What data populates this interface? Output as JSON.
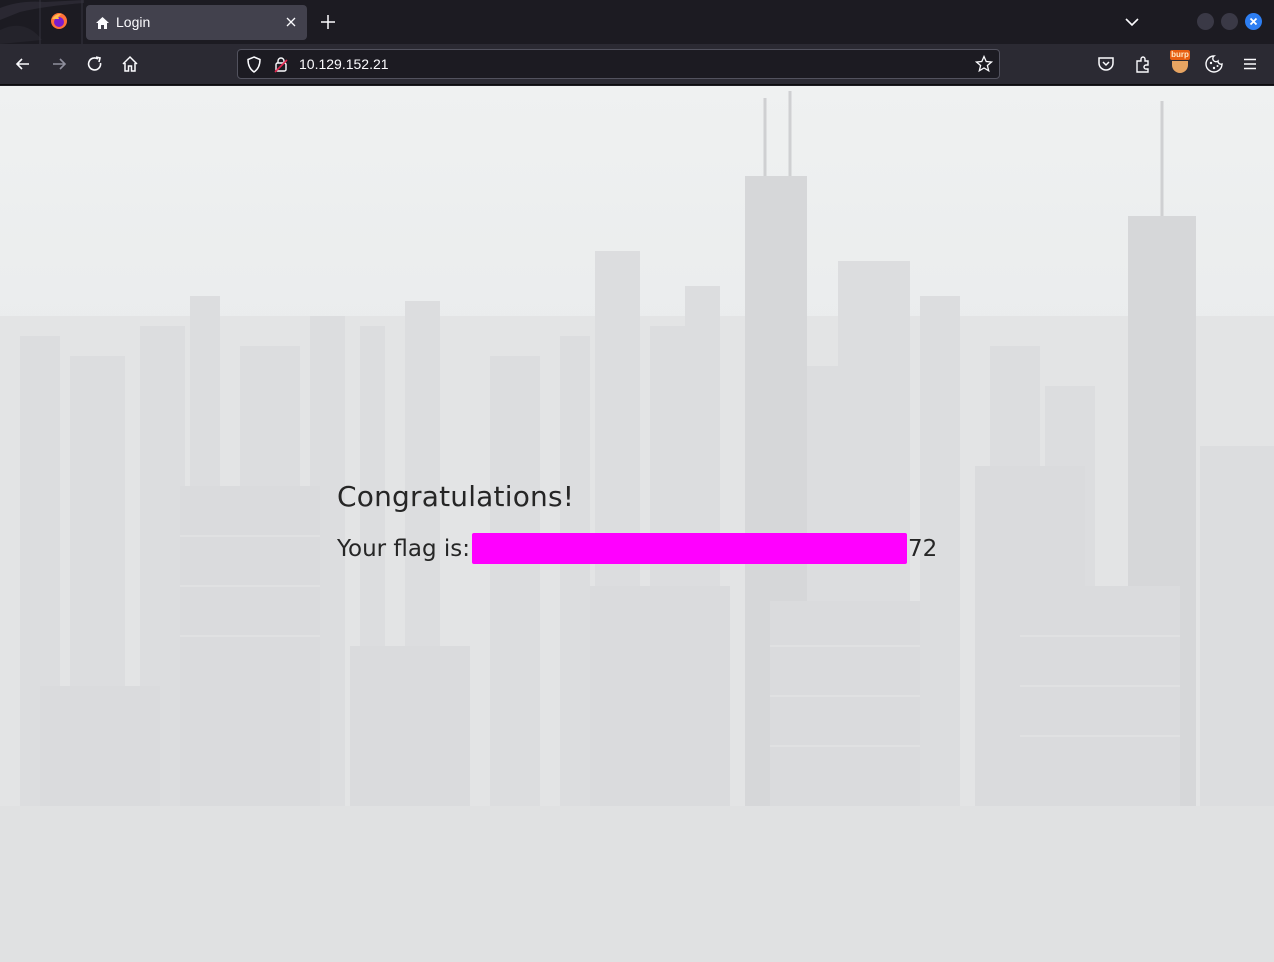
{
  "browser": {
    "tab": {
      "title": "Login"
    },
    "address_bar": {
      "url": "10.129.152.21"
    },
    "extensions": {
      "burp_label": "burp"
    }
  },
  "page": {
    "heading": "Congratulations!",
    "flag_label": "Your flag is:",
    "flag_suffix": "72",
    "redaction_color": "#ff00ff"
  },
  "colors": {
    "tabstrip": "#1c1b22",
    "toolbar": "#2b2a33",
    "active_tab": "#42414d",
    "close_button": "#2d7ef2",
    "page_background": "#eceded"
  },
  "icons": [
    "firefox-logo-icon",
    "home-icon",
    "close-icon",
    "plus-icon",
    "chevron-down-icon",
    "arrow-left-icon",
    "arrow-right-icon",
    "reload-icon",
    "shield-icon",
    "lock-icon",
    "star-icon",
    "pocket-icon",
    "extensions-icon",
    "burp-icon",
    "cookie-icon",
    "hamburger-menu-icon"
  ]
}
